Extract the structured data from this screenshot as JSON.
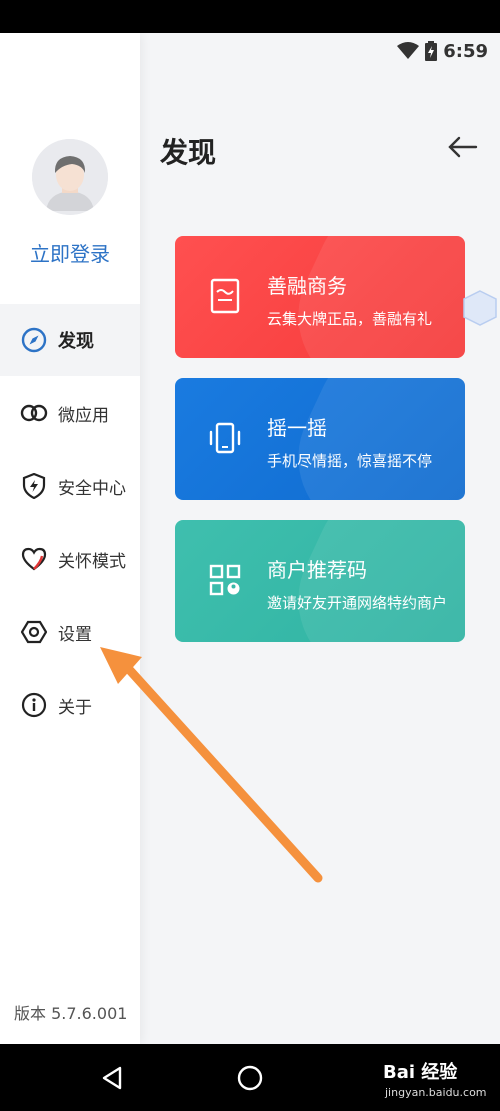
{
  "status_bar": {
    "time": "6:59"
  },
  "sidebar": {
    "login_label": "立即登录",
    "items": [
      {
        "label": "发现",
        "icon": "compass-icon",
        "active": true
      },
      {
        "label": "微应用",
        "icon": "link-icon"
      },
      {
        "label": "安全中心",
        "icon": "shield-icon"
      },
      {
        "label": "关怀模式",
        "icon": "heart-icon"
      },
      {
        "label": "设置",
        "icon": "settings-icon"
      },
      {
        "label": "关于",
        "icon": "info-icon"
      }
    ],
    "version": "版本 5.7.6.001"
  },
  "main": {
    "title": "发现",
    "cards": [
      {
        "title": "善融商务",
        "subtitle": "云集大牌正品，善融有礼",
        "color": "#f74444",
        "icon": "shop-icon"
      },
      {
        "title": "摇一摇",
        "subtitle": "手机尽情摇，惊喜摇不停",
        "color": "#1574d8",
        "icon": "shake-phone-icon"
      },
      {
        "title": "商户推荐码",
        "subtitle": "邀请好友开通网络特约商户",
        "color": "#38b9a8",
        "icon": "qr-code-icon"
      }
    ]
  },
  "watermark": {
    "brand": "Bai 经验",
    "url": "jingyan.baidu.com"
  },
  "colors": {
    "accent": "#2d73c6",
    "arrow": "#f5913d"
  }
}
